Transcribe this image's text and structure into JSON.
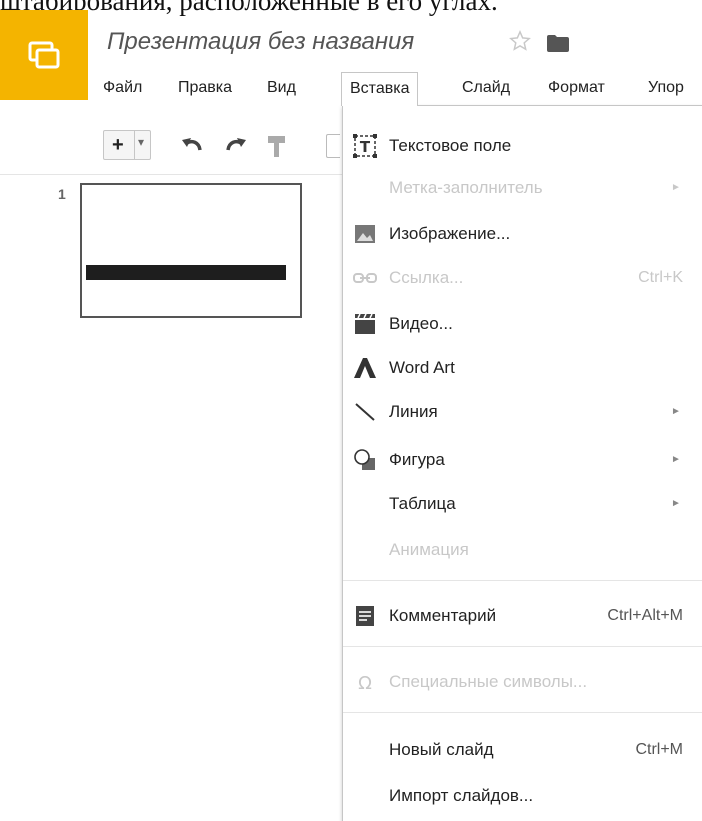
{
  "page_text": {
    "top_line": "штабирования, расположенные в его углах."
  },
  "header": {
    "title": "Презентация без названия",
    "logo_icon": "slides-logo-icon",
    "star_icon": "star-icon",
    "folder_icon": "folder-icon",
    "brand_color": "#f4b400"
  },
  "menubar": {
    "items": [
      {
        "label": "Файл"
      },
      {
        "label": "Правка"
      },
      {
        "label": "Вид"
      },
      {
        "label": "Вставка"
      },
      {
        "label": "Слайд"
      },
      {
        "label": "Формат"
      },
      {
        "label": "Упор"
      }
    ],
    "active": "Вставка"
  },
  "toolbar": {
    "add_label": "+",
    "caret_label": "▾",
    "icons": [
      "new-slide-icon",
      "undo-icon",
      "redo-icon",
      "paint-format-icon"
    ]
  },
  "filmstrip": {
    "slide_number": "1"
  },
  "insert_menu": {
    "items": [
      {
        "label": "Текстовое поле",
        "icon": "text-box-icon",
        "shortcut": "",
        "submenu": false,
        "disabled": false
      },
      {
        "label": "Метка-заполнитель",
        "icon": "",
        "shortcut": "",
        "submenu": true,
        "disabled": true
      },
      {
        "label": "Изображение...",
        "icon": "image-icon",
        "shortcut": "",
        "submenu": false,
        "disabled": false
      },
      {
        "label": "Ссылка...",
        "icon": "link-icon",
        "shortcut": "Ctrl+K",
        "submenu": false,
        "disabled": true
      },
      {
        "label": "Видео...",
        "icon": "video-icon",
        "shortcut": "",
        "submenu": false,
        "disabled": false
      },
      {
        "label": "Word Art",
        "icon": "word-art-icon",
        "shortcut": "",
        "submenu": false,
        "disabled": false
      },
      {
        "label": "Линия",
        "icon": "line-icon",
        "shortcut": "",
        "submenu": true,
        "disabled": false
      },
      {
        "label": "Фигура",
        "icon": "shape-icon",
        "shortcut": "",
        "submenu": true,
        "disabled": false
      },
      {
        "label": "Таблица",
        "icon": "",
        "shortcut": "",
        "submenu": true,
        "disabled": false
      },
      {
        "label": "Анимация",
        "icon": "",
        "shortcut": "",
        "submenu": false,
        "disabled": true
      },
      {
        "label": "Комментарий",
        "icon": "comment-icon",
        "shortcut": "Ctrl+Alt+M",
        "submenu": false,
        "disabled": false
      },
      {
        "label": "Специальные символы...",
        "icon": "omega-icon",
        "shortcut": "",
        "submenu": false,
        "disabled": true
      },
      {
        "label": "Новый слайд",
        "icon": "",
        "shortcut": "Ctrl+M",
        "submenu": false,
        "disabled": false
      },
      {
        "label": "Импорт слайдов...",
        "icon": "",
        "shortcut": "",
        "submenu": false,
        "disabled": false
      }
    ],
    "submenu_arrow": "►"
  }
}
